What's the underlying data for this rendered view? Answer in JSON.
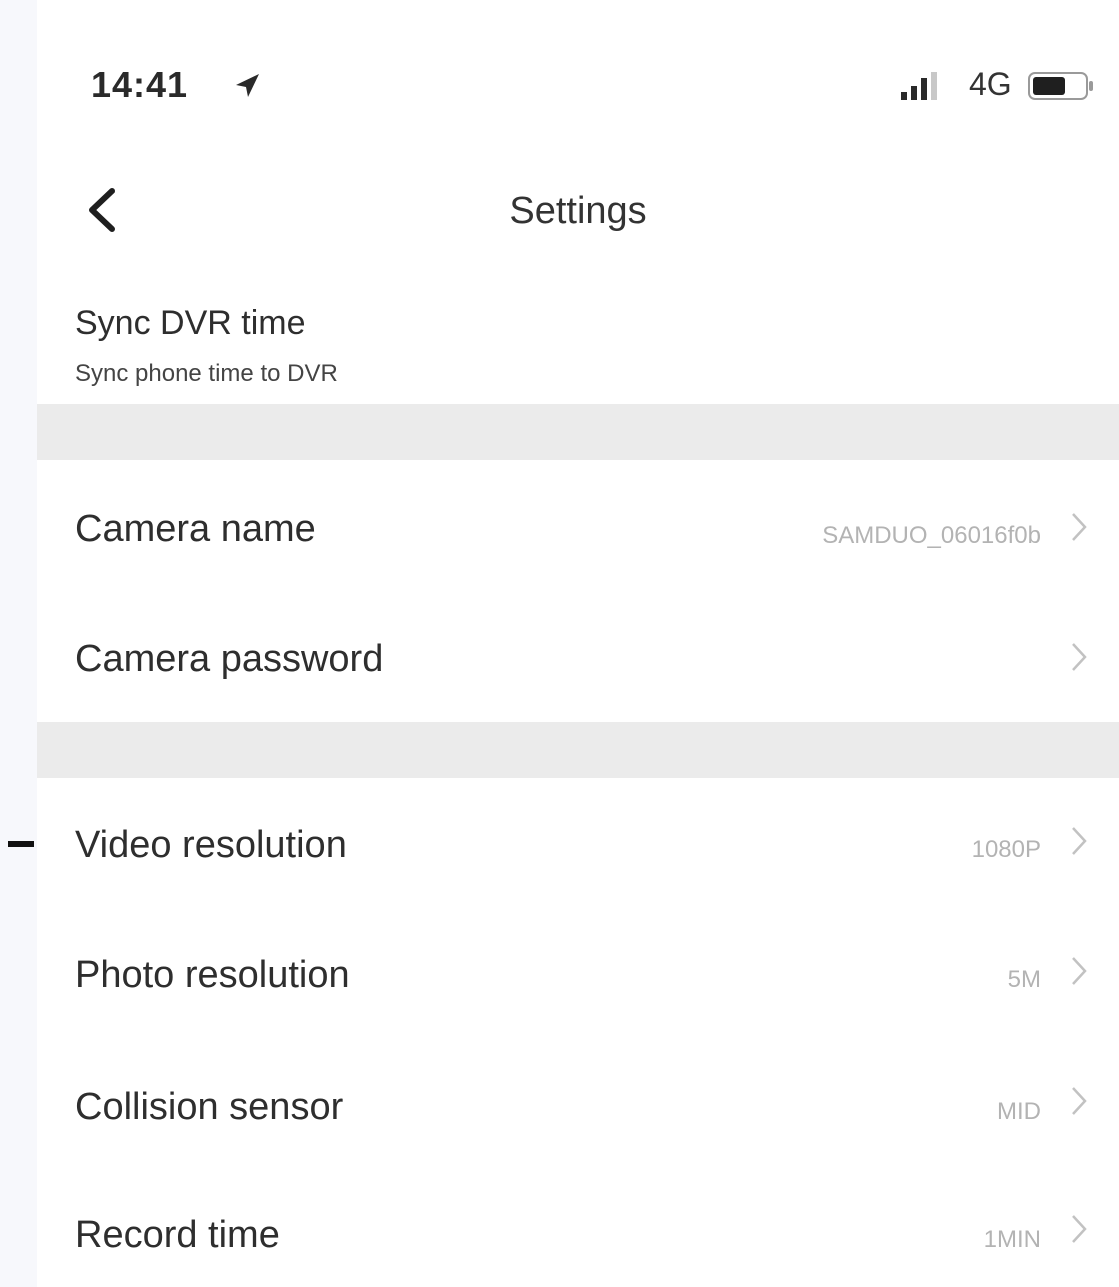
{
  "status_bar": {
    "time": "14:41",
    "network": "4G",
    "location_icon": "location-arrow-icon",
    "signal_icon": "signal-bars-icon",
    "battery_icon": "battery-icon"
  },
  "nav": {
    "back_icon": "chevron-left-icon",
    "title": "Settings"
  },
  "sync": {
    "title": "Sync DVR time",
    "subtitle": "Sync phone time to DVR"
  },
  "group1": [
    {
      "label": "Camera name",
      "value": "SAMDUO_06016f0b"
    },
    {
      "label": "Camera password",
      "value": ""
    }
  ],
  "group2": [
    {
      "label": "Video resolution",
      "value": "1080P"
    },
    {
      "label": "Photo resolution",
      "value": "5M"
    },
    {
      "label": "Collision sensor",
      "value": "MID"
    },
    {
      "label": "Record time",
      "value": "1MIN"
    }
  ],
  "colors": {
    "background": "#f7f8fc",
    "screen": "#ffffff",
    "separator": "#ebebeb",
    "value_text": "#b3b3b3",
    "chevron": "#c2c2c2"
  }
}
